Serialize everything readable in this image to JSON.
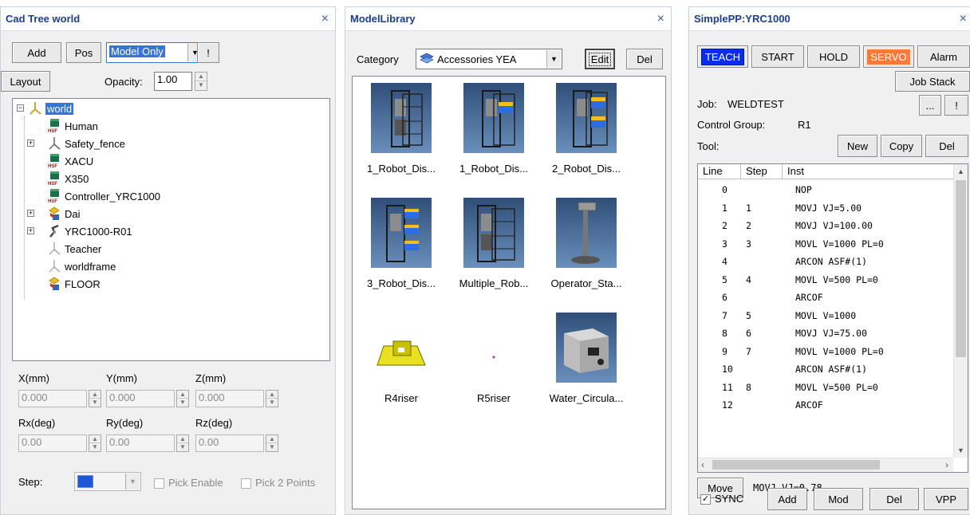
{
  "cad_tree": {
    "title": "Cad Tree world",
    "close": "×",
    "add_label": "Add",
    "pos_label": "Pos",
    "mode_value": "Model Only",
    "bang_label": "!",
    "layout_label": "Layout",
    "opacity_label": "Opacity:",
    "opacity_value": "1.00",
    "tree": [
      {
        "label": "world",
        "icon": "world-icon"
      },
      {
        "label": "Human",
        "icon": "hsf-model-icon"
      },
      {
        "label": "Safety_fence",
        "icon": "frame-icon"
      },
      {
        "label": "XACU",
        "icon": "hsf-model-icon"
      },
      {
        "label": "X350",
        "icon": "hsf-model-icon"
      },
      {
        "label": "Controller_YRC1000",
        "icon": "hsf-model-icon"
      },
      {
        "label": "Dai",
        "icon": "part-icon"
      },
      {
        "label": "YRC1000-R01",
        "icon": "robot-icon"
      },
      {
        "label": "Teacher",
        "icon": "frame-icon"
      },
      {
        "label": "worldframe",
        "icon": "frame-icon"
      },
      {
        "label": "FLOOR",
        "icon": "part-icon"
      }
    ],
    "x_label": "X(mm)",
    "y_label": "Y(mm)",
    "z_label": "Z(mm)",
    "x_value": "0.000",
    "y_value": "0.000",
    "z_value": "0.000",
    "rx_label": "Rx(deg)",
    "ry_label": "Ry(deg)",
    "rz_label": "Rz(deg)",
    "rx_value": "0.00",
    "ry_value": "0.00",
    "rz_value": "0.00",
    "step_label": "Step:",
    "pick_enable_label": "Pick Enable",
    "pick_2points_label": "Pick 2 Points"
  },
  "model_library": {
    "title": "ModelLibrary",
    "close": "×",
    "category_label": "Category",
    "category_value": "Accessories YEA",
    "edit_label": "Edit",
    "del_label": "Del",
    "items": [
      {
        "caption": "1_Robot_Dis..."
      },
      {
        "caption": "1_Robot_Dis..."
      },
      {
        "caption": "2_Robot_Dis..."
      },
      {
        "caption": "3_Robot_Dis..."
      },
      {
        "caption": "Multiple_Rob..."
      },
      {
        "caption": "Operator_Sta..."
      },
      {
        "caption": "R4riser"
      },
      {
        "caption": "R5riser"
      },
      {
        "caption": "Water_Circula..."
      }
    ]
  },
  "simple_pp": {
    "title": "SimplePP:YRC1000",
    "close": "×",
    "teach_label": "TEACH",
    "start_label": "START",
    "hold_label": "HOLD",
    "servo_label": "SERVO",
    "alarm_label": "Alarm",
    "job_stack_label": "Job Stack",
    "job_label": "Job:",
    "job_value": "WELDTEST",
    "ellipsis_label": "...",
    "bang_label": "!",
    "control_group_label": "Control Group:",
    "control_group_value": "R1",
    "tool_label": "Tool:",
    "new_label": "New",
    "copy_label": "Copy",
    "del_label": "Del",
    "col_line": "Line",
    "col_step": "Step",
    "col_inst": "Inst",
    "rows": [
      {
        "line": "0",
        "step": "",
        "inst": "NOP"
      },
      {
        "line": "1",
        "step": "1",
        "inst": "MOVJ VJ=5.00"
      },
      {
        "line": "2",
        "step": "2",
        "inst": "MOVJ VJ=100.00"
      },
      {
        "line": "3",
        "step": "3",
        "inst": "MOVL V=1000 PL=0"
      },
      {
        "line": "4",
        "step": "",
        "inst": "ARCON ASF#(1)"
      },
      {
        "line": "5",
        "step": "4",
        "inst": "MOVL V=500 PL=0"
      },
      {
        "line": "6",
        "step": "",
        "inst": "ARCOF"
      },
      {
        "line": "7",
        "step": "5",
        "inst": "MOVL V=1000"
      },
      {
        "line": "8",
        "step": "6",
        "inst": "MOVJ VJ=75.00"
      },
      {
        "line": "9",
        "step": "7",
        "inst": "MOVL V=1000 PL=0"
      },
      {
        "line": "10",
        "step": "",
        "inst": "ARCON ASF#(1)"
      },
      {
        "line": "11",
        "step": "8",
        "inst": "MOVL V=500 PL=0"
      },
      {
        "line": "12",
        "step": "",
        "inst": "ARCOF"
      }
    ],
    "move_label": "Move",
    "move_value": "MOVJ VJ=0.78",
    "sync_label": "SYNC",
    "add_label": "Add",
    "mod_label": "Mod",
    "del2_label": "Del",
    "vpp_label": "VPP",
    "colors": {
      "teach": "#0a2cf0",
      "servo": "#ff7a3a"
    }
  }
}
